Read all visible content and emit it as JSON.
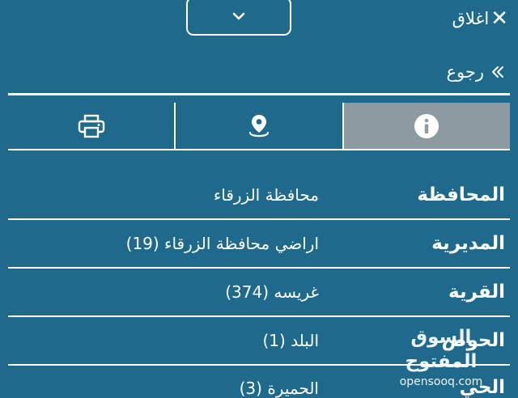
{
  "header": {
    "close_label": "اغلاق",
    "close_icon": "close-icon",
    "collapse_icon": "chevron-down-icon"
  },
  "nav": {
    "back_label": "رجوع",
    "back_icon": "double-chevron-right-icon"
  },
  "tabs": [
    {
      "id": "print",
      "icon": "printer-icon",
      "active": false
    },
    {
      "id": "location",
      "icon": "location-pin-icon",
      "active": false
    },
    {
      "id": "info",
      "icon": "info-icon",
      "active": true
    }
  ],
  "details": [
    {
      "label": "المحافظة",
      "value": "محافظة الزرقاء"
    },
    {
      "label": "المديرية",
      "value": "اراضي محافظة الزرقاء (19)"
    },
    {
      "label": "القرية",
      "value": "غريسه (374)"
    },
    {
      "label": "الحوض",
      "value": "البلد (1)"
    },
    {
      "label": "الحي",
      "value": "الحميرة (3)"
    }
  ],
  "watermark": {
    "arabic": "السوق المفتوح",
    "latin": "opensooq.com"
  },
  "colors": {
    "background": "#1f6a8c",
    "active_tab": "#8d9aa1",
    "foreground": "#ffffff"
  }
}
